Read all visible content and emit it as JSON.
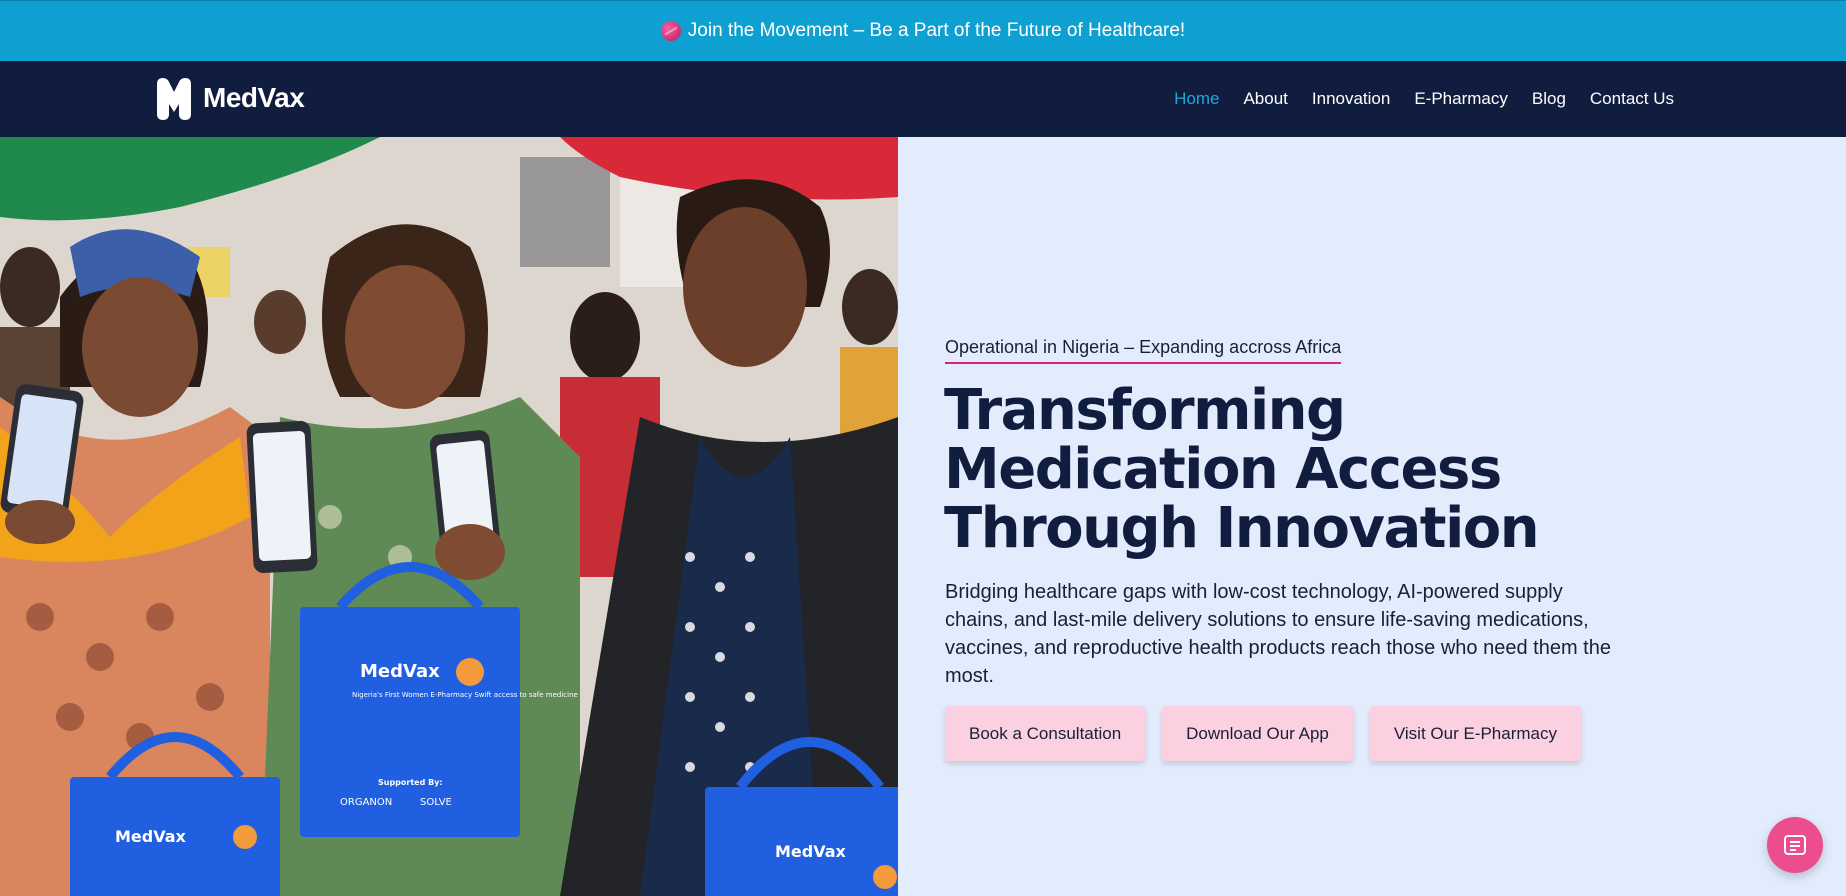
{
  "announcement": {
    "text": "Join the Movement – Be a Part of the Future of Healthcare!",
    "icon": "globe-icon"
  },
  "brand": {
    "name": "MedVax"
  },
  "nav": {
    "items": [
      {
        "label": "Home",
        "active": true
      },
      {
        "label": "About",
        "active": false
      },
      {
        "label": "Innovation",
        "active": false
      },
      {
        "label": "E-Pharmacy",
        "active": false
      },
      {
        "label": "Blog",
        "active": false
      },
      {
        "label": "Contact Us",
        "active": false
      }
    ]
  },
  "hero": {
    "tagline": "Operational in Nigeria – Expanding accross Africa",
    "headline_lines": [
      "Transforming",
      "Medication Access",
      "Through Innovation"
    ],
    "subtext": "Bridging healthcare gaps with low-cost technology, AI-powered supply chains, and last-mile delivery solutions to ensure life-saving medications, vaccines, and reproductive health products reach those who need them the most.",
    "buttons": [
      "Book a Consultation",
      "Download Our App",
      "Visit Our E-Pharmacy"
    ],
    "photo": {
      "bag_brand": "MedVax",
      "bag_tagline": "Nigeria's First Women E-Pharmacy Swift access to safe medicine",
      "supported_by": "Supported By:",
      "sponsors": [
        "ORGANON",
        "SOLVE"
      ]
    }
  },
  "chat": {
    "icon": "chat-icon"
  },
  "colors": {
    "announcement_bg": "#0fa0d2",
    "nav_bg": "#111d3f",
    "nav_active": "#1ea7d8",
    "hero_bg": "#e2ecfd",
    "headline": "#111d3f",
    "accent_pink": "#d6246e",
    "button_bg": "#fbd0e1",
    "chat_bg": "#ec4d8f"
  }
}
